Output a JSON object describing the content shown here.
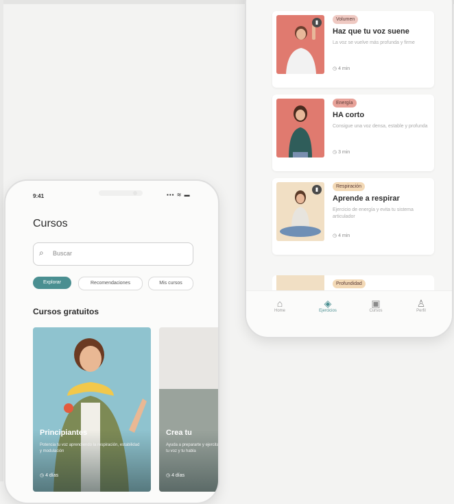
{
  "screens": {
    "left": {
      "status_time": "9:41",
      "status_icons": "▪▪▪ ≋ ▬",
      "title": "Cursos",
      "search": {
        "icon": "search-icon",
        "placeholder": "Buscar"
      },
      "chips": [
        "Explorar",
        "Recomendaciones",
        "Mis cursos"
      ],
      "section_title": "Cursos gratuitos",
      "courses": [
        {
          "title": "Principiantes",
          "desc": "Potencia tu voz aprendiendo la respiración, estabilidad y modulación",
          "duration": "4 días"
        },
        {
          "title": "Crea tu",
          "desc": "Ayuda a prepararte y ejercitar tu voz y tu habla",
          "duration": "4 días"
        }
      ]
    },
    "right": {
      "cards": [
        {
          "tag": "Volumen",
          "title": "Haz que tu voz suene",
          "desc": "La voz se vuelve más profunda y firme",
          "duration": "4 min"
        },
        {
          "tag": "Energía",
          "title": "HA corto",
          "desc": "Consigue una voz densa, estable y profunda",
          "duration": "3 min"
        },
        {
          "tag": "Respiración",
          "title": "Aprende a respirar",
          "desc": "Ejercicio de energía y evita tu sistema articulador",
          "duration": "4 min"
        },
        {
          "tag": "Profundidad"
        }
      ],
      "tabs": [
        {
          "label": "Home",
          "icon": "home-icon"
        },
        {
          "label": "Ejercicios",
          "icon": "exercises-icon"
        },
        {
          "label": "Cursos",
          "icon": "courses-icon"
        },
        {
          "label": "Perfil",
          "icon": "profile-icon"
        }
      ],
      "active_tab": "Ejercicios"
    }
  },
  "colors": {
    "accent": "#4a8f91",
    "salmon": "#e07a6f",
    "background": "#f3f3f2"
  }
}
